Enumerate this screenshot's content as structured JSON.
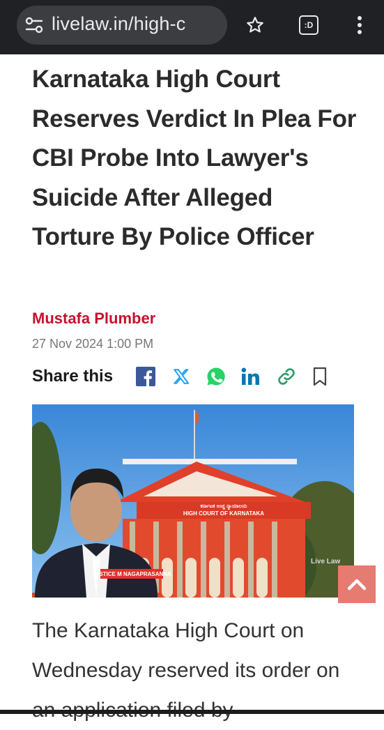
{
  "browser": {
    "url": "livelaw.in/high-c",
    "tab_count_label": ":D"
  },
  "article": {
    "headline": "Karnataka High Court Reserves Verdict In Plea For CBI Probe Into Lawyer's Suicide After Alleged Torture By Police Officer",
    "author": "Mustafa Plumber",
    "date": "27 Nov 2024 1:00 PM",
    "share_label": "Share this",
    "body_text": "The Karnataka High Court on Wednesday reserved its order on an application filed by"
  },
  "hero_image": {
    "building_sign_kannada": "ಕರ್ನಾಟಕ ಉಚ್ಚ ನ್ಯಾಯಾಲಯ",
    "building_sign": "HIGH COURT OF KARNATAKA",
    "caption": "JUSTICE M NAGAPRASANNA",
    "watermark": "Live Law"
  },
  "colors": {
    "author_red": "#c8102e",
    "facebook": "#3b5998",
    "twitter": "#1da1f2",
    "whatsapp": "#25d366",
    "linkedin": "#0077b5",
    "link": "#2e9c6e",
    "scroll_top": "#e57b71"
  },
  "icons": [
    "page-info-icon",
    "star-icon",
    "tab-switcher-icon",
    "more-vert-icon",
    "facebook-icon",
    "x-icon",
    "whatsapp-icon",
    "linkedin-icon",
    "link-icon",
    "bookmark-icon",
    "chevron-up-icon"
  ]
}
